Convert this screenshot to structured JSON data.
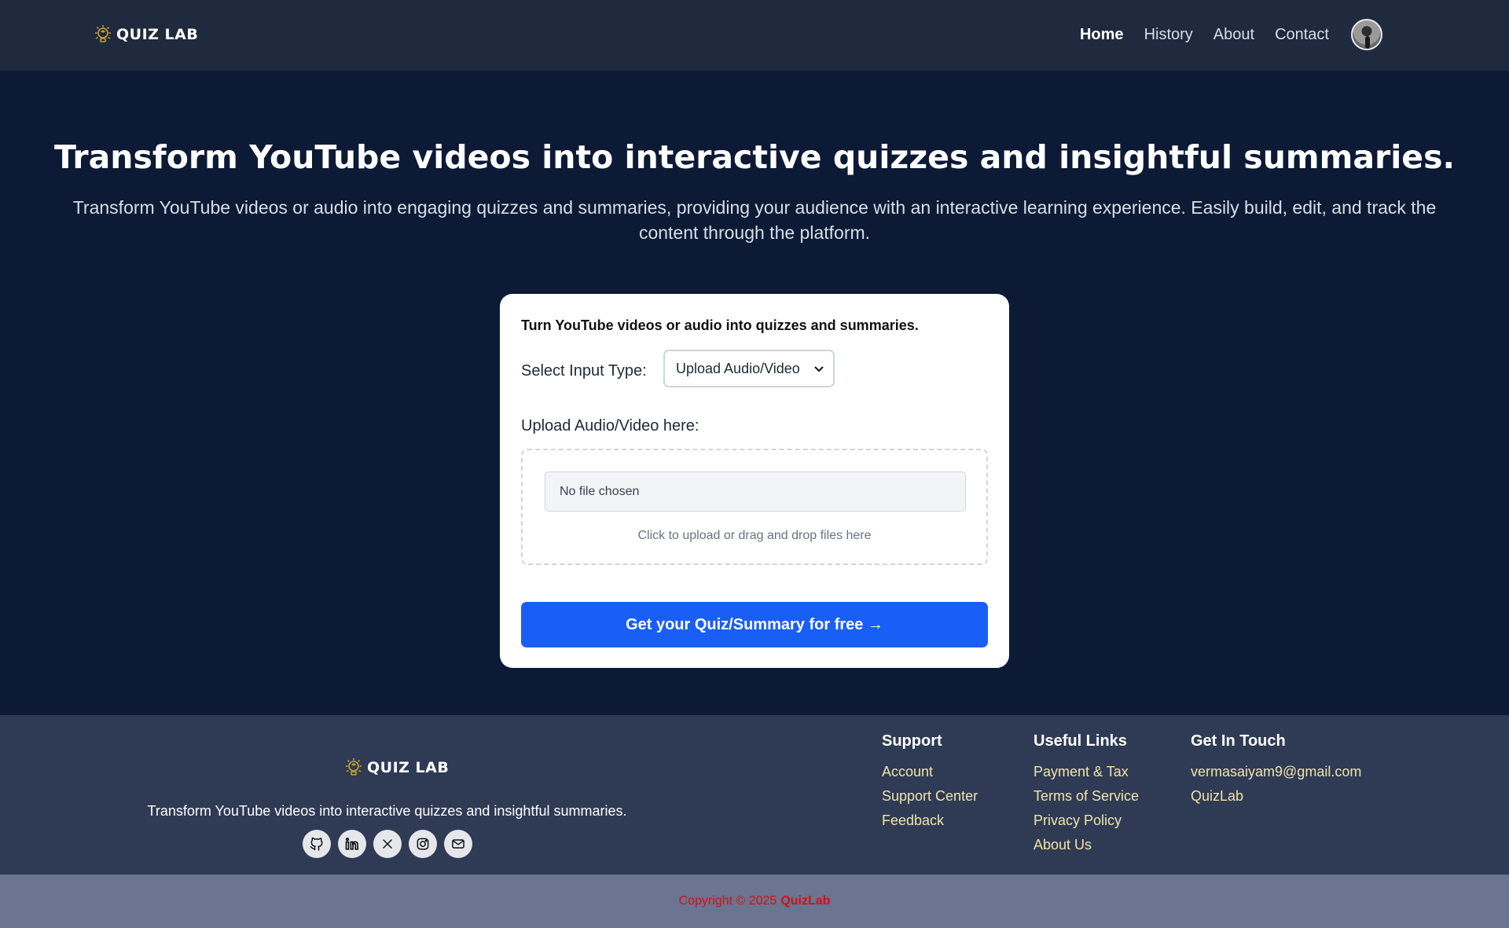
{
  "header": {
    "logo_text": "QUIZ LAB",
    "nav": [
      {
        "label": "Home",
        "active": true
      },
      {
        "label": "History",
        "active": false
      },
      {
        "label": "About",
        "active": false
      },
      {
        "label": "Contact",
        "active": false
      }
    ]
  },
  "hero": {
    "title": "Transform YouTube videos into interactive quizzes and insightful summaries.",
    "subtitle": "Transform YouTube videos or audio into engaging quizzes and summaries, providing your audience with an interactive learning experience. Easily build, edit, and track the content through the platform."
  },
  "card": {
    "title": "Turn YouTube videos or audio into quizzes and summaries.",
    "input_type_label": "Select Input Type:",
    "input_type_value": "Upload Audio/Video",
    "upload_label": "Upload Audio/Video here:",
    "file_status": "No file chosen",
    "drop_hint": "Click to upload or drag and drop files here",
    "cta": "Get your Quiz/Summary for free →"
  },
  "footer": {
    "logo_text": "QUIZ LAB",
    "tagline": "Transform YouTube videos into interactive quizzes and insightful summaries.",
    "socials": [
      "github-icon",
      "linkedin-icon",
      "x-icon",
      "instagram-icon",
      "mail-icon"
    ],
    "support": {
      "heading": "Support",
      "links": [
        "Account",
        "Support Center",
        "Feedback"
      ]
    },
    "useful": {
      "heading": "Useful Links",
      "links": [
        "Payment & Tax",
        "Terms of Service",
        "Privacy Policy",
        "About Us"
      ]
    },
    "contact": {
      "heading": "Get In Touch",
      "links": [
        "vermasaiyam9@gmail.com",
        "QuizLab"
      ]
    },
    "copyright_prefix": "Copyright © 2025",
    "copyright_brand": "QuizLab"
  },
  "colors": {
    "page_bg": "#0c1a35",
    "header_bg": "#1f2a3e",
    "footer_bg": "#2f3b55",
    "copyright_bg": "#6b7490",
    "cta_blue": "#1a5ff5",
    "footer_link": "#f1e4a6",
    "copyright_red": "#d11212"
  }
}
